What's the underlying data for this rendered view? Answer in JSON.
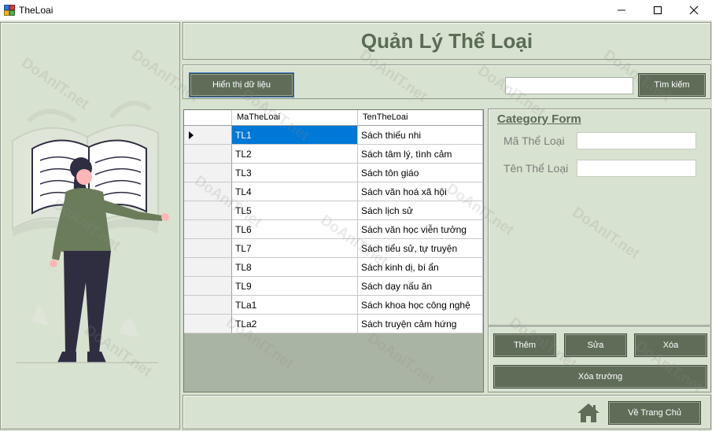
{
  "window": {
    "title": "TheLoai"
  },
  "header": {
    "title": "Quản Lý Thể Loại"
  },
  "toolbar": {
    "show_data_label": "Hiển thị dữ liệu",
    "search_value": "",
    "search_label": "Tìm kiếm"
  },
  "grid": {
    "columns": [
      "MaTheLoai",
      "TenTheLoai"
    ],
    "rows": [
      {
        "id": "TL1",
        "name": "Sách thiếu nhi"
      },
      {
        "id": "TL2",
        "name": "Sách tâm lý, tình cảm"
      },
      {
        "id": "TL3",
        "name": "Sách tôn giáo"
      },
      {
        "id": "TL4",
        "name": "Sách văn hoá xã hội"
      },
      {
        "id": "TL5",
        "name": "Sách lịch sử"
      },
      {
        "id": "TL6",
        "name": " Sách văn học viễn tưởng"
      },
      {
        "id": "TL7",
        "name": "Sách tiểu sử, tự truyện"
      },
      {
        "id": "TL8",
        "name": "Sách kinh dị, bí ẩn"
      },
      {
        "id": "TL9",
        "name": "Sách dạy nấu ăn"
      },
      {
        "id": "TLa1",
        "name": "Sách khoa học công nghệ"
      },
      {
        "id": "TLa2",
        "name": "Sách truyện cảm hứng"
      }
    ]
  },
  "form": {
    "title": "Category Form",
    "id_label": "Mã Thể Loại",
    "id_value": "",
    "name_label": "Tên Thể Loại",
    "name_value": ""
  },
  "actions": {
    "add_label": "Thêm",
    "edit_label": "Sửa",
    "delete_label": "Xóa",
    "clear_label": "Xóa trường"
  },
  "footer": {
    "home_label": "Về Trang Chủ"
  },
  "watermark": "DoAnIT.net",
  "icons": {
    "app": "form-icon",
    "home": "home-icon",
    "minimize": "minimize-icon",
    "maximize": "maximize-icon",
    "close": "close-icon",
    "row_indicator": "row-indicator-icon"
  },
  "colors": {
    "background": "#d8e2d0",
    "button": "#5f6d58",
    "title": "#5a6b56",
    "selection": "#0078d7"
  }
}
